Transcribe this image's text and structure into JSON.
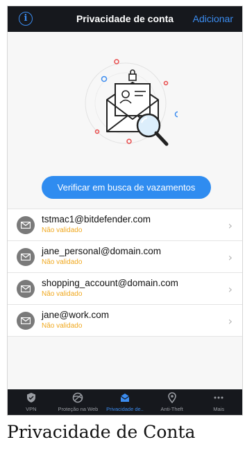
{
  "header": {
    "title": "Privacidade de conta",
    "add_label": "Adicionar",
    "info_glyph": "i"
  },
  "hero": {
    "scan_button_label": "Verificar em busca de vazamentos"
  },
  "accounts": [
    {
      "email": "tstmac1@bitdefender.com",
      "status": "Não validado"
    },
    {
      "email": "jane_personal@domain.com",
      "status": "Não validado"
    },
    {
      "email": "shopping_account@domain.com",
      "status": "Não validado"
    },
    {
      "email": "jane@work.com",
      "status": "Não validado"
    }
  ],
  "tabs": [
    {
      "label": "VPN",
      "icon": "shield-icon",
      "active": false
    },
    {
      "label": "Proteção na Web",
      "icon": "globe-icon",
      "active": false
    },
    {
      "label": "Privacidade de..",
      "icon": "privacy-inbox-icon",
      "active": true
    },
    {
      "label": "Anti-Theft",
      "icon": "location-pin-icon",
      "active": false
    },
    {
      "label": "Mais",
      "icon": "more-icon",
      "active": false
    }
  ],
  "caption": "Privacidade de Conta",
  "colors": {
    "accent": "#2f8cf0",
    "warning": "#f0a81e",
    "bar": "#16181d"
  }
}
